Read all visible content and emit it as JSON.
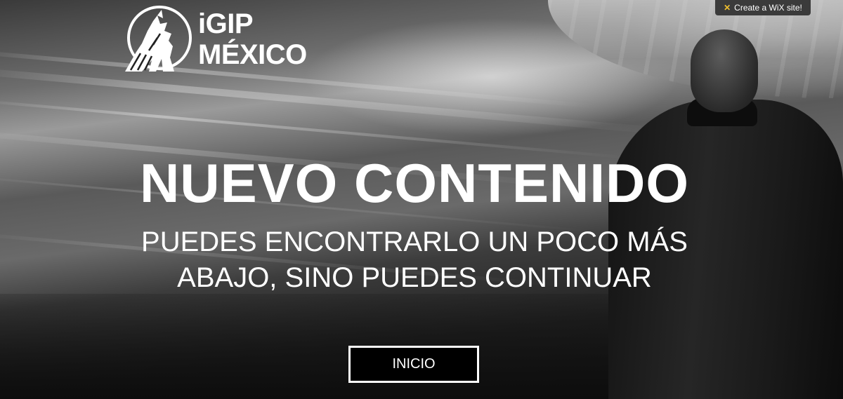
{
  "brand": {
    "line1": "iGIP",
    "line2": "MÉXICO",
    "logo_icon": "howling-wolf-icon"
  },
  "wix_badge": {
    "label": "Create a WiX site!",
    "icon": "wix-star-icon",
    "icon_color": "#f2c12e"
  },
  "hero": {
    "headline": "NUEVO CONTENIDO",
    "subline_1": "PUEDES ENCONTRARLO UN POCO MÁS",
    "subline_2": "ABAJO, SINO PUEDES CONTINUAR",
    "button_label": "INICIO"
  },
  "colors": {
    "text": "#ffffff",
    "button_bg": "#000000",
    "badge_bg": "#3b3b3b"
  }
}
